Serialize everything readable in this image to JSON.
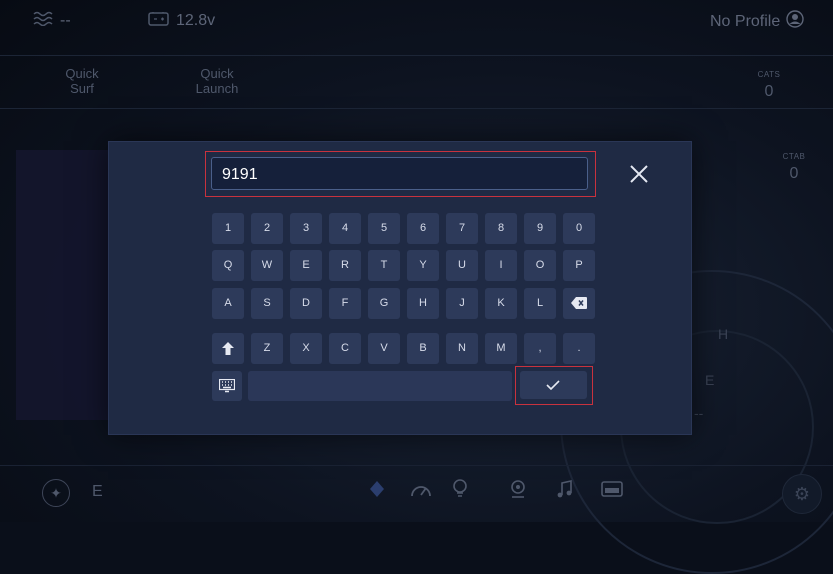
{
  "status": {
    "water_temp": "--",
    "battery": "12.8v",
    "profile": "No Profile"
  },
  "quick": {
    "surf": "Quick\nSurf",
    "launch": "Quick\nLaunch"
  },
  "side": {
    "stat1_label": "CATS",
    "stat1_value": "0",
    "stat2_label": "CTAB",
    "stat2_value": "0"
  },
  "gauge": {
    "letter_h": "H",
    "letter_e": "E",
    "dash": "--"
  },
  "bottom": {
    "heading": "E"
  },
  "keyboard": {
    "input_value": "9191",
    "row1": [
      "1",
      "2",
      "3",
      "4",
      "5",
      "6",
      "7",
      "8",
      "9",
      "0"
    ],
    "row2": [
      "Q",
      "W",
      "E",
      "R",
      "T",
      "Y",
      "U",
      "I",
      "O",
      "P"
    ],
    "row3": [
      "A",
      "S",
      "D",
      "F",
      "G",
      "H",
      "J",
      "K",
      "L"
    ],
    "row4": [
      "Z",
      "X",
      "C",
      "V",
      "B",
      "N",
      "M",
      ",",
      "."
    ]
  },
  "colors": {
    "modal_bg": "#1f2a44",
    "key_bg": "#2d3a5a",
    "highlight": "#c8323e"
  }
}
